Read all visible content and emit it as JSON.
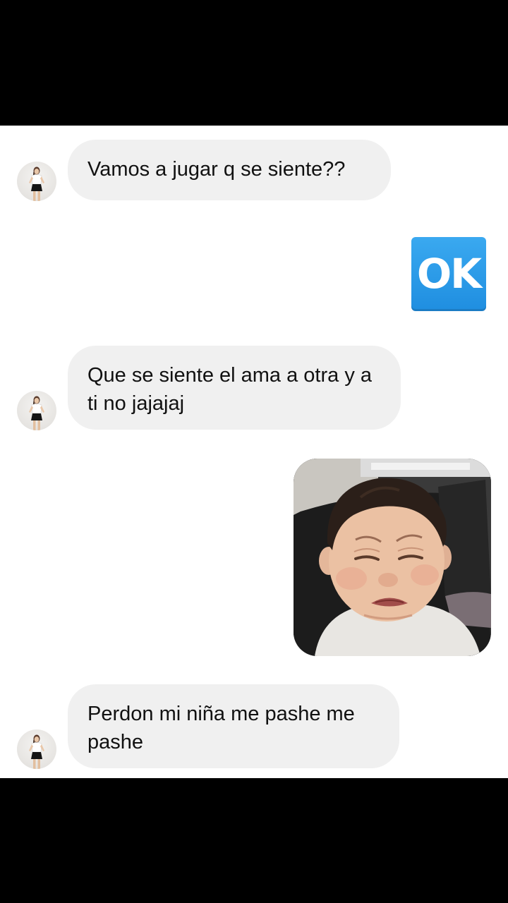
{
  "conversation": {
    "messages": [
      {
        "sender": "contact",
        "type": "text",
        "text": "Vamos a jugar q se siente??"
      },
      {
        "sender": "me",
        "type": "emoji",
        "text": "OK",
        "icon": "ok-button-emoji",
        "color": "#2196e8"
      },
      {
        "sender": "contact",
        "type": "text",
        "text": "Que se siente el ama a otra y a ti no jajajaj"
      },
      {
        "sender": "me",
        "type": "sticker",
        "icon": "crying-baby-sticker"
      },
      {
        "sender": "contact",
        "type": "text",
        "text": "Perdon mi niña me pashe me pashe"
      }
    ]
  },
  "colors": {
    "bubble_background": "#f0f0f0",
    "chat_background": "#ffffff",
    "letterbox": "#000000"
  }
}
